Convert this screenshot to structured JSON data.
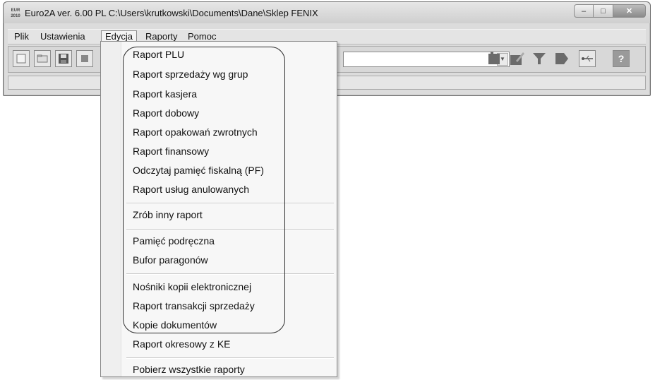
{
  "window": {
    "title": "Euro2A ver. 6.00 PL   C:\\Users\\krutkowski\\Documents\\Dane\\Sklep FENIX",
    "icon_text": "EUR 2010"
  },
  "menubar": {
    "items": [
      "Plik",
      "Ustawienia",
      "Edycja",
      "Raporty",
      "Pomoc"
    ],
    "active": "Edycja"
  },
  "toolbar": {
    "left_icons": [
      "new-file-icon",
      "open-icon",
      "save-icon",
      "print-icon"
    ],
    "right_icons": [
      "connect-device-icon",
      "edit-device-icon",
      "filter-icon",
      "export-icon",
      "usb-icon",
      "help-icon"
    ],
    "help_label": "?"
  },
  "dropdown": {
    "groups": [
      [
        "Raport PLU",
        "Raport sprzedaży wg grup",
        "Raport kasjera",
        "Raport dobowy",
        "Raport opakowań zwrotnych",
        "Raport finansowy",
        "Odczytaj pamięć fiskalną (PF)",
        "Raport usług anulowanych"
      ],
      [
        "Zrób inny raport"
      ],
      [
        "Pamięć podręczna",
        "Bufor paragonów"
      ],
      [
        "Nośniki kopii elektronicznej",
        "Raport transakcji sprzedaży",
        "Kopie dokumentów",
        "Raport okresowy z KE"
      ],
      [
        "Pobierz wszystkie raporty"
      ]
    ]
  },
  "colors": {
    "window_bg": "#dcdcdc",
    "menu_bg": "#f7f7f7",
    "highlight_frame": "#2a2a2a"
  }
}
